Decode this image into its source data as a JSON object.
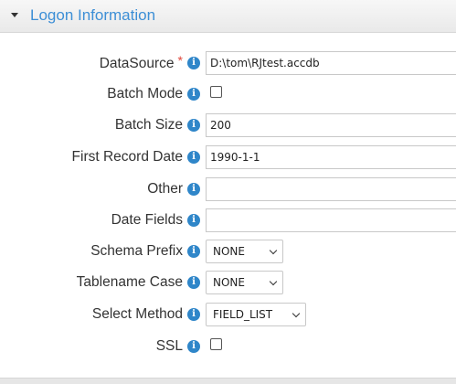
{
  "section": {
    "title": "Logon Information",
    "toggle_icon": "caret-down-icon"
  },
  "fields": {
    "datasource": {
      "label": "DataSource",
      "required_mark": "*",
      "value": "D:\\tom\\RJtest.accdb"
    },
    "batch_mode": {
      "label": "Batch Mode",
      "checked": false
    },
    "batch_size": {
      "label": "Batch Size",
      "value": "200"
    },
    "first_record_date": {
      "label": "First Record Date",
      "value": "1990-1-1"
    },
    "other": {
      "label": "Other",
      "value": ""
    },
    "date_fields": {
      "label": "Date Fields",
      "value": ""
    },
    "schema_prefix": {
      "label": "Schema Prefix",
      "selected": "NONE"
    },
    "tablename_case": {
      "label": "Tablename Case",
      "selected": "NONE"
    },
    "select_method": {
      "label": "Select Method",
      "selected": "FIELD_LIST"
    },
    "ssl": {
      "label": "SSL",
      "checked": false
    }
  },
  "info_icon": {
    "name": "info-icon",
    "glyph": "i"
  },
  "colors": {
    "title": "#3d8fd6",
    "info": "#2f86c9",
    "required": "#e0463a"
  }
}
